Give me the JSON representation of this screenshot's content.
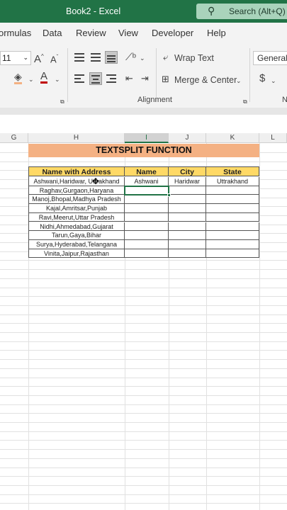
{
  "titlebar": {
    "title": "Book2  -  Excel",
    "search_placeholder": "Search (Alt+Q)"
  },
  "tabs": [
    "ormulas",
    "Data",
    "Review",
    "View",
    "Developer",
    "Help"
  ],
  "ribbon": {
    "font_size": "11",
    "wrap_text": "Wrap Text",
    "merge_center": "Merge & Center",
    "number_format": "General",
    "alignment_label": "Alignment",
    "number_label": "N",
    "currency_symbol": "$"
  },
  "columns": [
    {
      "label": "G",
      "selected": false
    },
    {
      "label": "H",
      "selected": false
    },
    {
      "label": "I",
      "selected": true
    },
    {
      "label": "J",
      "selected": false
    },
    {
      "label": "K",
      "selected": false
    },
    {
      "label": "L",
      "selected": false
    }
  ],
  "sheet": {
    "banner": "TEXTSPLIT FUNCTION",
    "headers": [
      "Name with Address",
      "Name",
      "City",
      "State"
    ],
    "rows": [
      [
        "Ashwani,Haridwar, Uttrakhand",
        "Ashwani",
        "Haridwar",
        "Uttrakhand"
      ],
      [
        "Raghav,Gurgaon,Haryana",
        "",
        "",
        ""
      ],
      [
        "Manoj,Bhopal,Madhya Pradesh",
        "",
        "",
        ""
      ],
      [
        "Kajal,Amritsar,Punjab",
        "",
        "",
        ""
      ],
      [
        "Ravi,Meerut,Uttar Pradesh",
        "",
        "",
        ""
      ],
      [
        "Nidhi,Ahmedabad,Gujarat",
        "",
        "",
        ""
      ],
      [
        "Tarun,Gaya,Bihar",
        "",
        "",
        ""
      ],
      [
        "Surya,Hyderabad,Telangana",
        "",
        "",
        ""
      ],
      [
        "Vinita,Jaipur,Rajasthan",
        "",
        "",
        ""
      ]
    ]
  }
}
